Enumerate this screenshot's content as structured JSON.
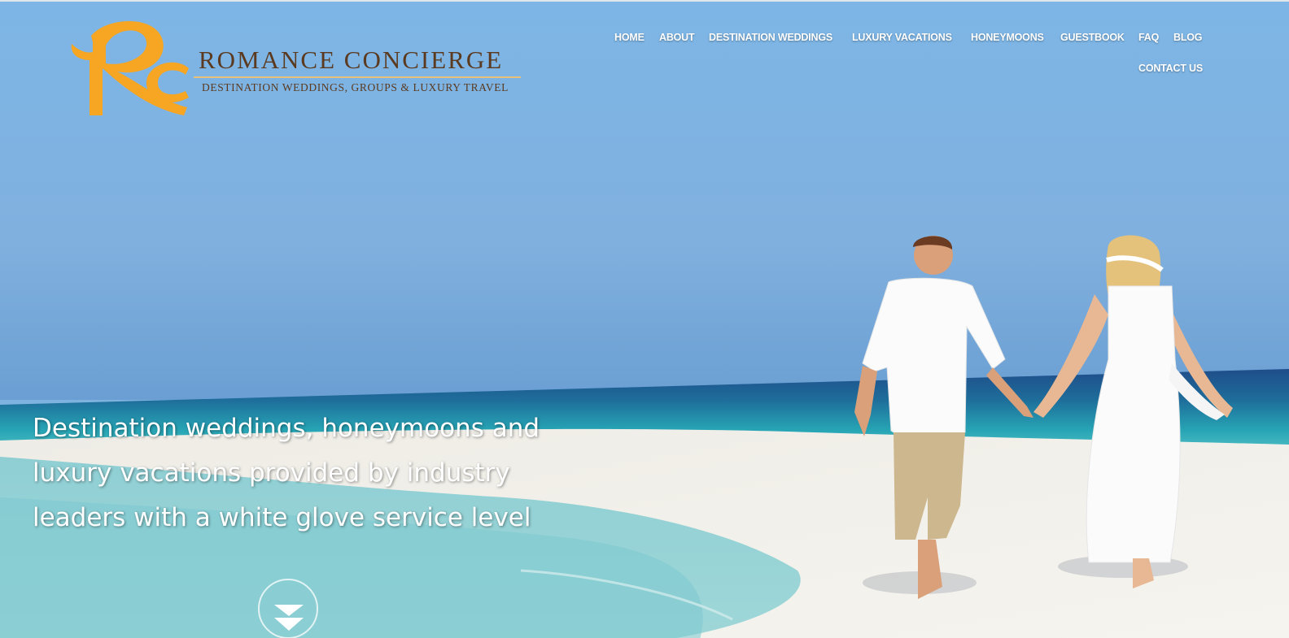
{
  "header": {
    "brand_name": "ROMANCE CONCIERGE",
    "brand_tagline": "DESTINATION WEDDINGS, GROUPS & LUXURY TRAVEL"
  },
  "nav": {
    "items": [
      {
        "label": "HOME"
      },
      {
        "label": "ABOUT"
      },
      {
        "label": "DESTINATION WEDDINGS"
      },
      {
        "label": "LUXURY VACATIONS"
      },
      {
        "label": "HONEYMOONS"
      },
      {
        "label": "GUESTBOOK"
      },
      {
        "label": "FAQ"
      },
      {
        "label": "BLOG"
      },
      {
        "label": "CONTACT US"
      }
    ]
  },
  "hero": {
    "headline": "Destination weddings, honeymoons and luxury vacations provided by industry leaders with a white glove service level"
  },
  "icons": {
    "logo": "rc-monogram-icon",
    "scroll": "chevron-down-icon"
  },
  "colors": {
    "brand_orange": "#f6a623",
    "brand_brown": "#5b3a1f",
    "nav_text": "#ffffff"
  }
}
